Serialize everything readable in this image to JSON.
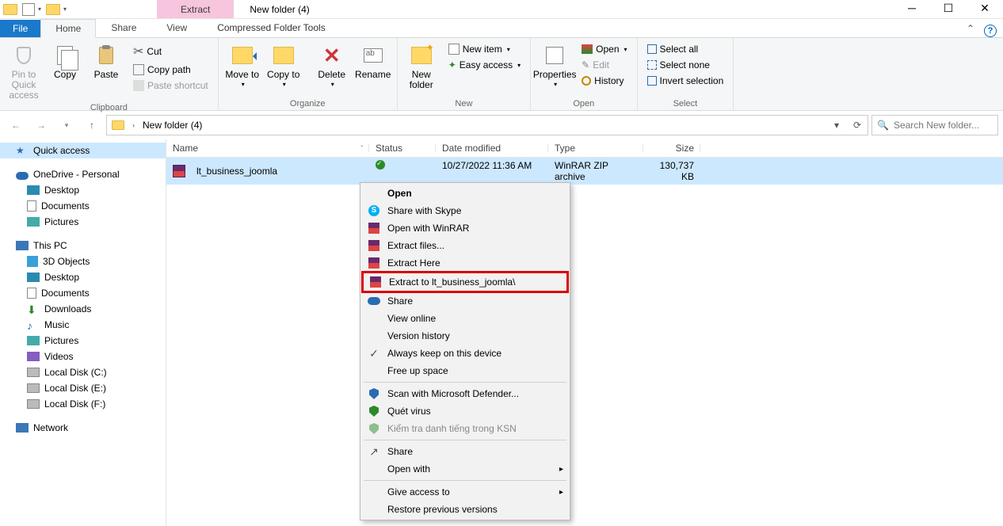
{
  "title": "New folder (4)",
  "context_tab": {
    "top": "Extract",
    "bottom": "Compressed Folder Tools"
  },
  "tabs": {
    "file": "File",
    "home": "Home",
    "share": "Share",
    "view": "View"
  },
  "ribbon": {
    "clipboard": {
      "label": "Clipboard",
      "pin": "Pin to Quick access",
      "copy": "Copy",
      "paste": "Paste",
      "cut": "Cut",
      "copy_path": "Copy path",
      "paste_shortcut": "Paste shortcut"
    },
    "organize": {
      "label": "Organize",
      "move": "Move to",
      "copy": "Copy to",
      "delete": "Delete",
      "rename": "Rename"
    },
    "new": {
      "label": "New",
      "new_folder": "New folder",
      "new_item": "New item",
      "easy_access": "Easy access"
    },
    "open": {
      "label": "Open",
      "properties": "Properties",
      "open": "Open",
      "edit": "Edit",
      "history": "History"
    },
    "select": {
      "label": "Select",
      "all": "Select all",
      "none": "Select none",
      "invert": "Invert selection"
    }
  },
  "breadcrumb": {
    "root": "",
    "folder": "New folder (4)"
  },
  "search_placeholder": "Search New folder...",
  "columns": {
    "name": "Name",
    "status": "Status",
    "date": "Date modified",
    "type": "Type",
    "size": "Size"
  },
  "file_row": {
    "name": "lt_business_joomla",
    "date": "10/27/2022 11:36 AM",
    "type": "WinRAR ZIP archive",
    "size": "130,737 KB"
  },
  "sidebar": {
    "quick": "Quick access",
    "onedrive": "OneDrive - Personal",
    "od_items": [
      "Desktop",
      "Documents",
      "Pictures"
    ],
    "thispc": "This PC",
    "pc_items": [
      "3D Objects",
      "Desktop",
      "Documents",
      "Downloads",
      "Music",
      "Pictures",
      "Videos",
      "Local Disk (C:)",
      "Local Disk (E:)",
      "Local Disk (F:)"
    ],
    "network": "Network"
  },
  "context_menu": {
    "open": "Open",
    "skype": "Share with Skype",
    "open_winrar": "Open with WinRAR",
    "extract_files": "Extract files...",
    "extract_here": "Extract Here",
    "extract_to": "Extract to lt_business_joomla\\",
    "share": "Share",
    "view_online": "View online",
    "version_history": "Version history",
    "always_keep": "Always keep on this device",
    "free_up": "Free up space",
    "defender": "Scan with Microsoft Defender...",
    "quet": "Quét virus",
    "ksn": "Kiểm tra danh tiếng trong KSN",
    "share2": "Share",
    "open_with": "Open with",
    "give_access": "Give access to",
    "restore": "Restore previous versions"
  }
}
